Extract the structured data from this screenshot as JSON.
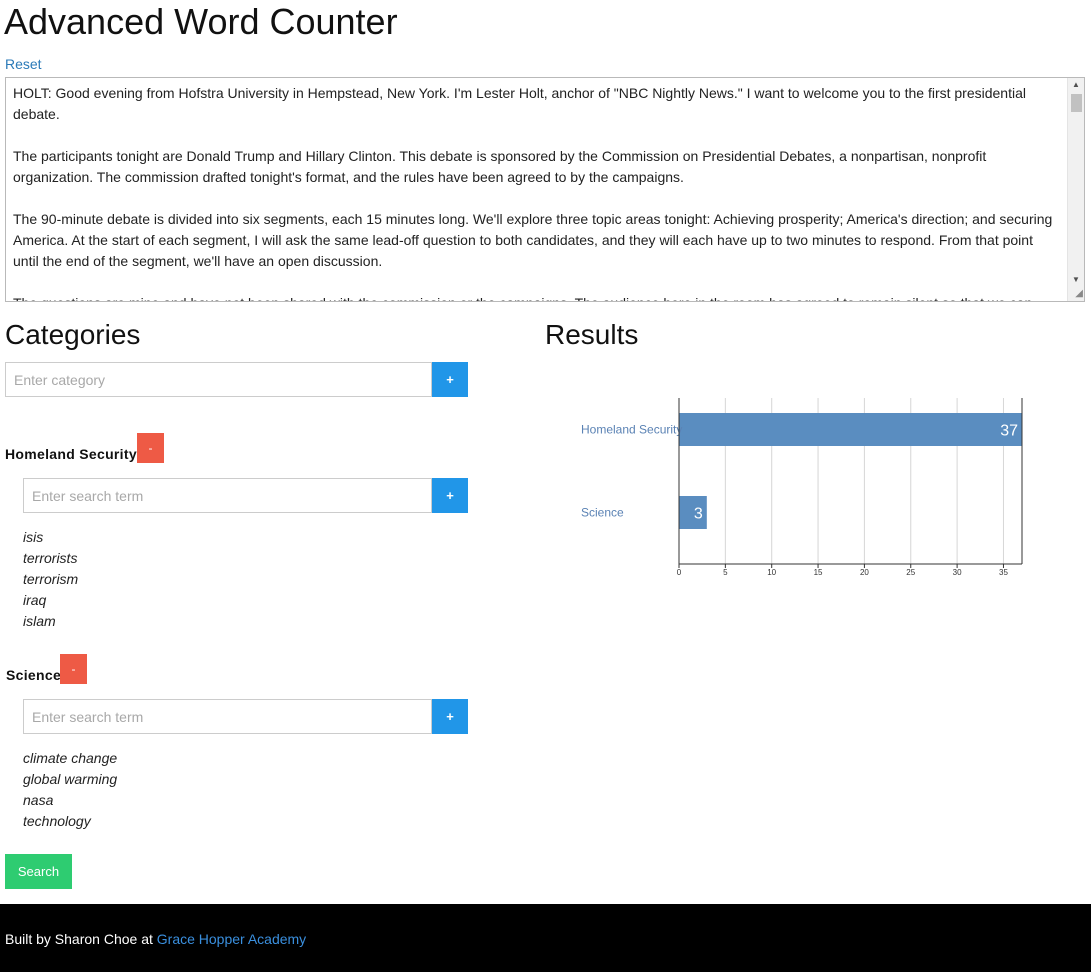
{
  "header": {
    "title": "Advanced Word Counter",
    "reset_label": "Reset"
  },
  "text_input": {
    "paragraphs": [
      "HOLT: Good evening from Hofstra University in Hempstead, New York. I'm Lester Holt, anchor of \"NBC Nightly News.\" I want to welcome you to the first presidential debate.",
      "The participants tonight are Donald Trump and Hillary Clinton. This debate is sponsored by the Commission on Presidential Debates, a nonpartisan, nonprofit organization. The commission drafted tonight's format, and the rules have been agreed to by the campaigns.",
      "The 90-minute debate is divided into six segments, each 15 minutes long. We'll explore three topic areas tonight: Achieving prosperity; America's direction; and securing America. At the start of each segment, I will ask the same lead-off question to both candidates, and they will each have up to two minutes to respond. From that point until the end of the segment, we'll have an open discussion.",
      "The questions are mine and have not been shared with the commission or the campaigns. The audience here in the room has agreed to remain silent so that we can"
    ]
  },
  "categories": {
    "heading": "Categories",
    "new_category_placeholder": "Enter category",
    "add_label": "+",
    "remove_label": "-",
    "search_term_placeholder": "Enter search term",
    "items": [
      {
        "name": "Homeland Security",
        "terms": [
          "isis",
          "terrorists",
          "terrorism",
          "iraq",
          "islam"
        ]
      },
      {
        "name": "Science",
        "terms": [
          "climate change",
          "global warming",
          "nasa",
          "technology"
        ]
      }
    ],
    "search_label": "Search"
  },
  "results": {
    "heading": "Results"
  },
  "chart_data": {
    "type": "bar",
    "orientation": "horizontal",
    "categories": [
      "Homeland Security",
      "Science"
    ],
    "values": [
      37,
      3
    ],
    "xlim": [
      0,
      37
    ],
    "xticks": [
      0,
      5,
      10,
      15,
      20,
      25,
      30,
      35
    ],
    "grid": true,
    "bar_color": "#5a8dc0",
    "label_color": "#5a82b4"
  },
  "footer": {
    "prefix": "Built by Sharon Choe at ",
    "link_text": "Grace Hopper Academy"
  }
}
